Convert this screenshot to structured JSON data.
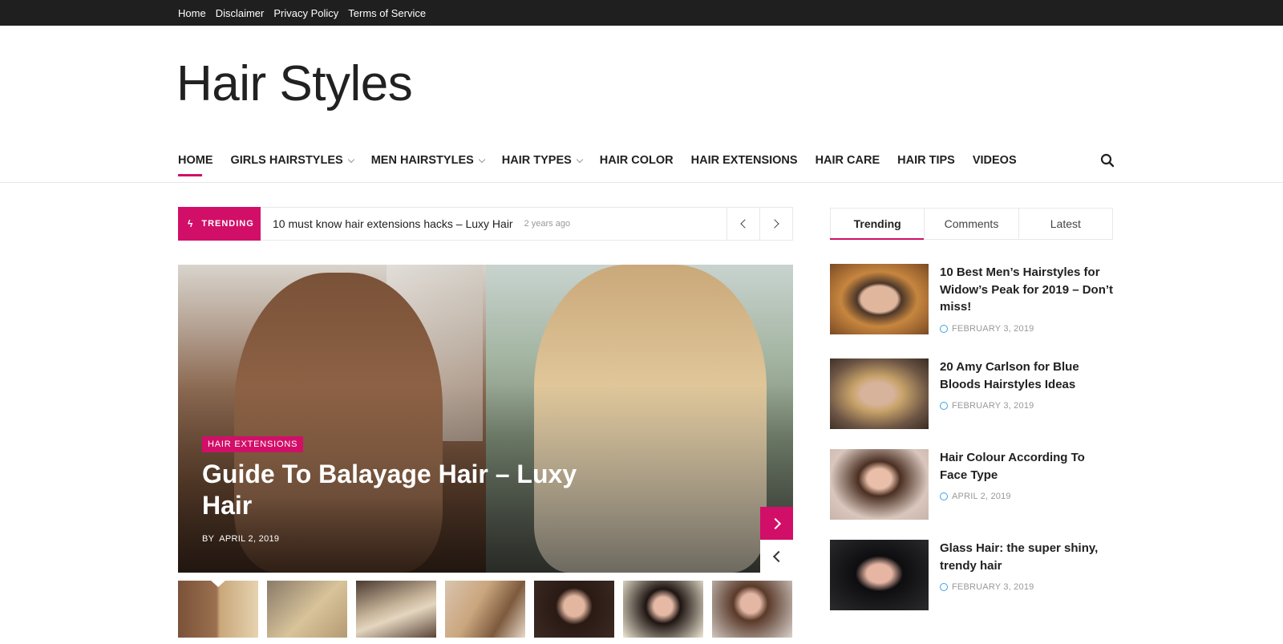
{
  "topbar": {
    "links": [
      "Home",
      "Disclaimer",
      "Privacy Policy",
      "Terms of Service"
    ]
  },
  "site": {
    "title": "Hair Styles"
  },
  "nav": {
    "items": [
      {
        "label": "HOME",
        "active": true,
        "dropdown": false
      },
      {
        "label": "GIRLS HAIRSTYLES",
        "dropdown": true
      },
      {
        "label": "MEN HAIRSTYLES",
        "dropdown": true
      },
      {
        "label": "HAIR TYPES",
        "dropdown": true
      },
      {
        "label": "HAIR COLOR",
        "dropdown": false
      },
      {
        "label": "HAIR EXTENSIONS",
        "dropdown": false
      },
      {
        "label": "HAIR CARE",
        "dropdown": false
      },
      {
        "label": "HAIR TIPS",
        "dropdown": false
      },
      {
        "label": "VIDEOS",
        "dropdown": false
      }
    ],
    "search_icon": "search-icon"
  },
  "trending": {
    "badge": "TRENDING",
    "headline": "10 must know hair extensions hacks – Luxy Hair",
    "ago": "2 years ago"
  },
  "hero": {
    "category": "HAIR EXTENSIONS",
    "title": "Guide To Balayage Hair – Luxy Hair",
    "by": "BY",
    "date": "APRIL 2, 2019"
  },
  "sidebar": {
    "tabs": [
      "Trending",
      "Comments",
      "Latest"
    ],
    "active_tab": "Trending",
    "posts": [
      {
        "title": "10 Best Men’s Hairstyles for Widow’s Peak for 2019 – Don’t miss!",
        "date": "FEBRUARY 3, 2019"
      },
      {
        "title": "20 Amy Carlson for Blue Bloods Hairstyles Ideas",
        "date": "FEBRUARY 3, 2019"
      },
      {
        "title": "Hair Colour According To Face Type",
        "date": "APRIL 2, 2019"
      },
      {
        "title": "Glass Hair: the super shiny, trendy hair",
        "date": "FEBRUARY 3, 2019"
      }
    ]
  },
  "colors": {
    "accent": "#d10f68",
    "topbar": "#1f1f1f",
    "date_icon": "#3aa3e3"
  }
}
